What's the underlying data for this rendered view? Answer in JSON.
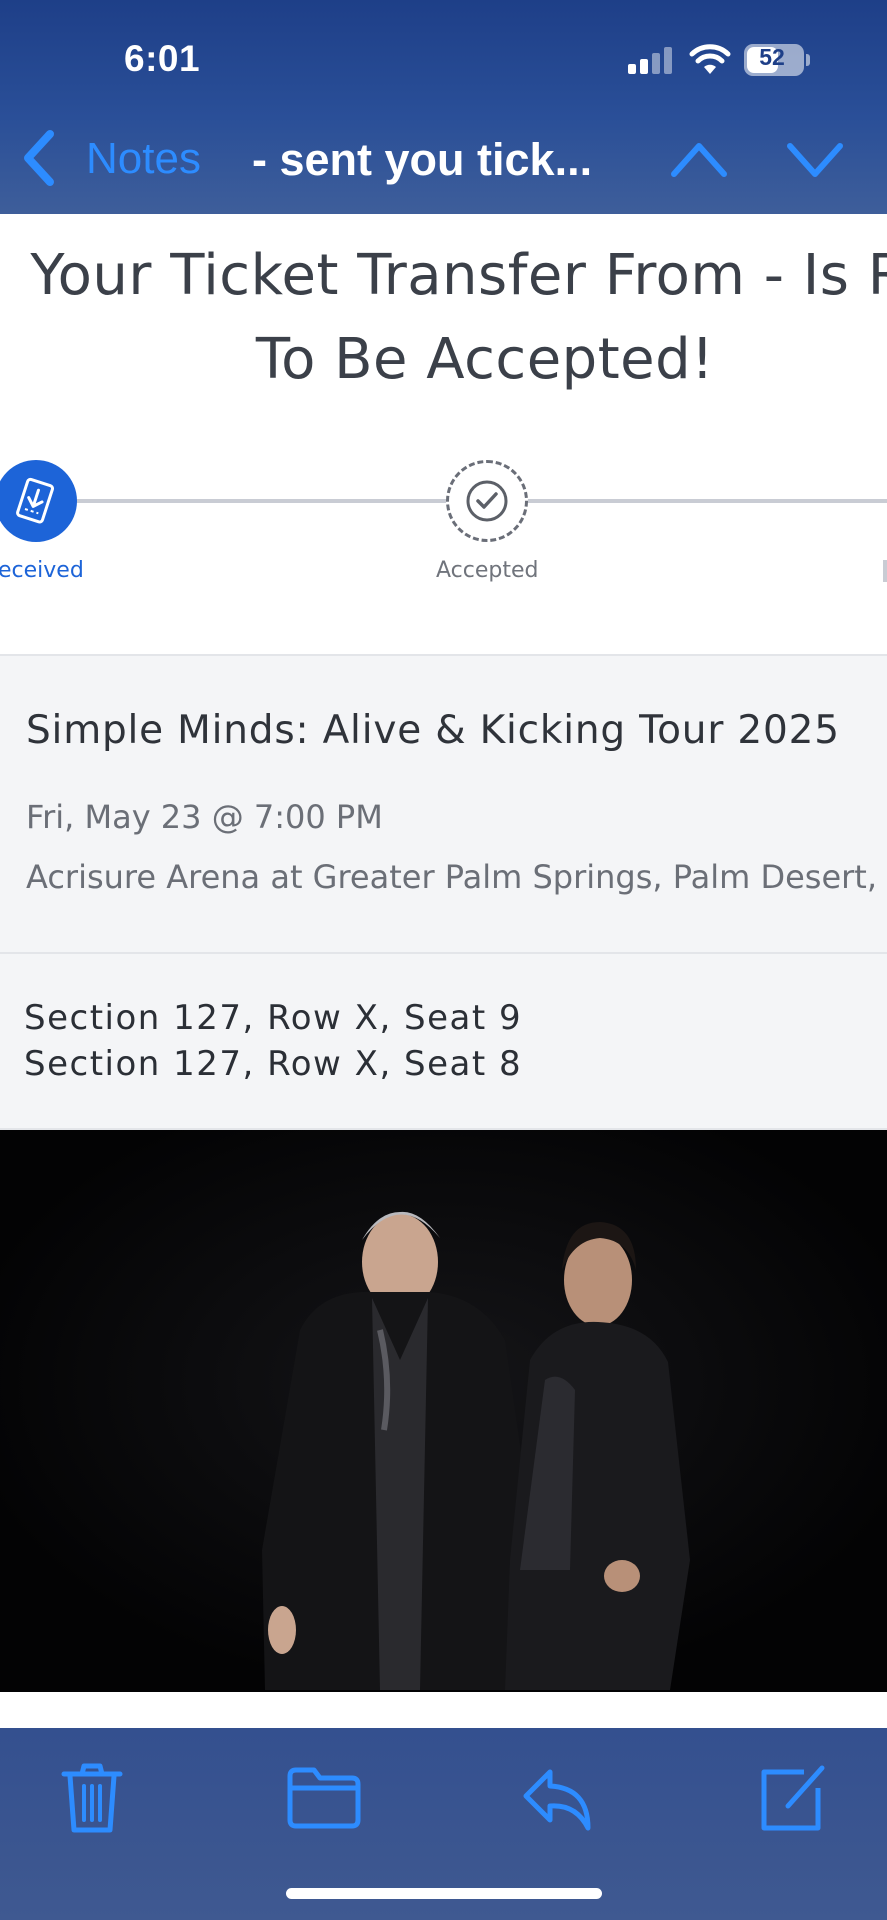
{
  "status_bar": {
    "time": "6:01",
    "battery": "52"
  },
  "nav": {
    "back_label": "Notes",
    "title": "- sent you tick..."
  },
  "email": {
    "headline_line1": "Your Ticket Transfer From - Is Re",
    "headline_line2": "To Be Accepted!",
    "steps": [
      {
        "label": "eceived",
        "state": "complete"
      },
      {
        "label": "Accepted",
        "state": "pending"
      }
    ],
    "event": {
      "name": "Simple Minds: Alive & Kicking Tour 2025",
      "date": "Fri, May 23 @ 7:00 PM",
      "venue": "Acrisure Arena at Greater Palm Springs, Palm Desert, C"
    },
    "seats": [
      "Section 127, Row X, Seat 9",
      "Section 127, Row X, Seat 8"
    ]
  },
  "toolbar": {
    "items": [
      {
        "icon": "trash-icon"
      },
      {
        "icon": "folder-icon"
      },
      {
        "icon": "reply-icon"
      },
      {
        "icon": "compose-icon"
      }
    ]
  },
  "colors": {
    "accent": "#2d8cff",
    "step_active": "#1d64d8",
    "bar_top": "#1e3f88"
  }
}
